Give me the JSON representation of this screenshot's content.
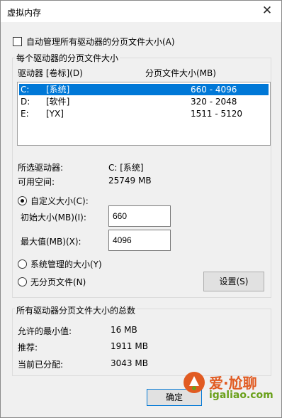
{
  "window": {
    "title": "虚拟内存",
    "close_glyph": "✕"
  },
  "auto_manage": {
    "label": "自动管理所有驱动器的分页文件大小(A)",
    "checked": false
  },
  "per_drive": {
    "group_title": "每个驱动器的分页文件大小",
    "col_drive": "驱动器 [卷标](D)",
    "col_size": "分页文件大小(MB)",
    "rows": [
      {
        "drive": "C:",
        "label": "[系统]",
        "size": "660 - 4096",
        "selected": true
      },
      {
        "drive": "D:",
        "label": "[软件]",
        "size": "320 - 2048",
        "selected": false
      },
      {
        "drive": "E:",
        "label": "[YX]",
        "size": "1511 - 5120",
        "selected": false
      }
    ]
  },
  "selected_drive": {
    "label": "所选驱动器:",
    "value": "C:  [系统]"
  },
  "free_space": {
    "label": "可用空间:",
    "value": "25749 MB"
  },
  "custom": {
    "label": "自定义大小(C):",
    "initial_label": "初始大小(MB)(I):",
    "initial_value": "660",
    "max_label": "最大值(MB)(X):",
    "max_value": "4096"
  },
  "system_managed": {
    "label": "系统管理的大小(Y)"
  },
  "no_paging": {
    "label": "无分页文件(N)"
  },
  "set_button": "设置(S)",
  "totals": {
    "group_title": "所有驱动器分页文件大小的总数",
    "min_label": "允许的最小值:",
    "min_value": "16 MB",
    "rec_label": "推荐:",
    "rec_value": "1911 MB",
    "cur_label": "当前已分配:",
    "cur_value": "3043 MB"
  },
  "ok_button": "确定",
  "watermark": {
    "line1": "爱·尬聊",
    "line2": "igaliao.com"
  }
}
